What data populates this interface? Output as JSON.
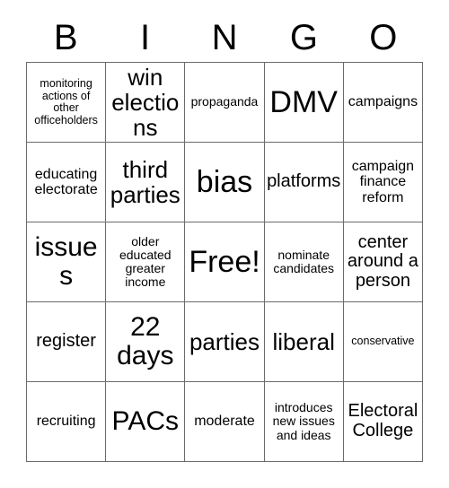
{
  "card": {
    "header_letters": [
      "B",
      "I",
      "N",
      "G",
      "O"
    ],
    "rows": [
      [
        {
          "text": "monitoring actions of other officeholders",
          "size": "xxs"
        },
        {
          "text": "win elections",
          "size": "lg"
        },
        {
          "text": "propaganda",
          "size": "xs"
        },
        {
          "text": "DMV",
          "size": "xxl"
        },
        {
          "text": "campaigns",
          "size": "sm"
        }
      ],
      [
        {
          "text": "educating electorate",
          "size": "sm"
        },
        {
          "text": "third parties",
          "size": "lg"
        },
        {
          "text": "bias",
          "size": "xxl"
        },
        {
          "text": "platforms",
          "size": "md"
        },
        {
          "text": "campaign finance reform",
          "size": "sm"
        }
      ],
      [
        {
          "text": "issues",
          "size": "xl"
        },
        {
          "text": "older educated greater income",
          "size": "xs"
        },
        {
          "text": "Free!",
          "size": "xxl"
        },
        {
          "text": "nominate candidates",
          "size": "xs"
        },
        {
          "text": "center around a person",
          "size": "md"
        }
      ],
      [
        {
          "text": "register",
          "size": "md"
        },
        {
          "text": "22 days",
          "size": "xl"
        },
        {
          "text": "parties",
          "size": "lg"
        },
        {
          "text": "liberal",
          "size": "lg"
        },
        {
          "text": "conservative",
          "size": "xxs"
        }
      ],
      [
        {
          "text": "recruiting",
          "size": "sm"
        },
        {
          "text": "PACs",
          "size": "xl"
        },
        {
          "text": "moderate",
          "size": "sm"
        },
        {
          "text": "introduces new issues and ideas",
          "size": "xs"
        },
        {
          "text": "Electoral College",
          "size": "md"
        }
      ]
    ]
  }
}
